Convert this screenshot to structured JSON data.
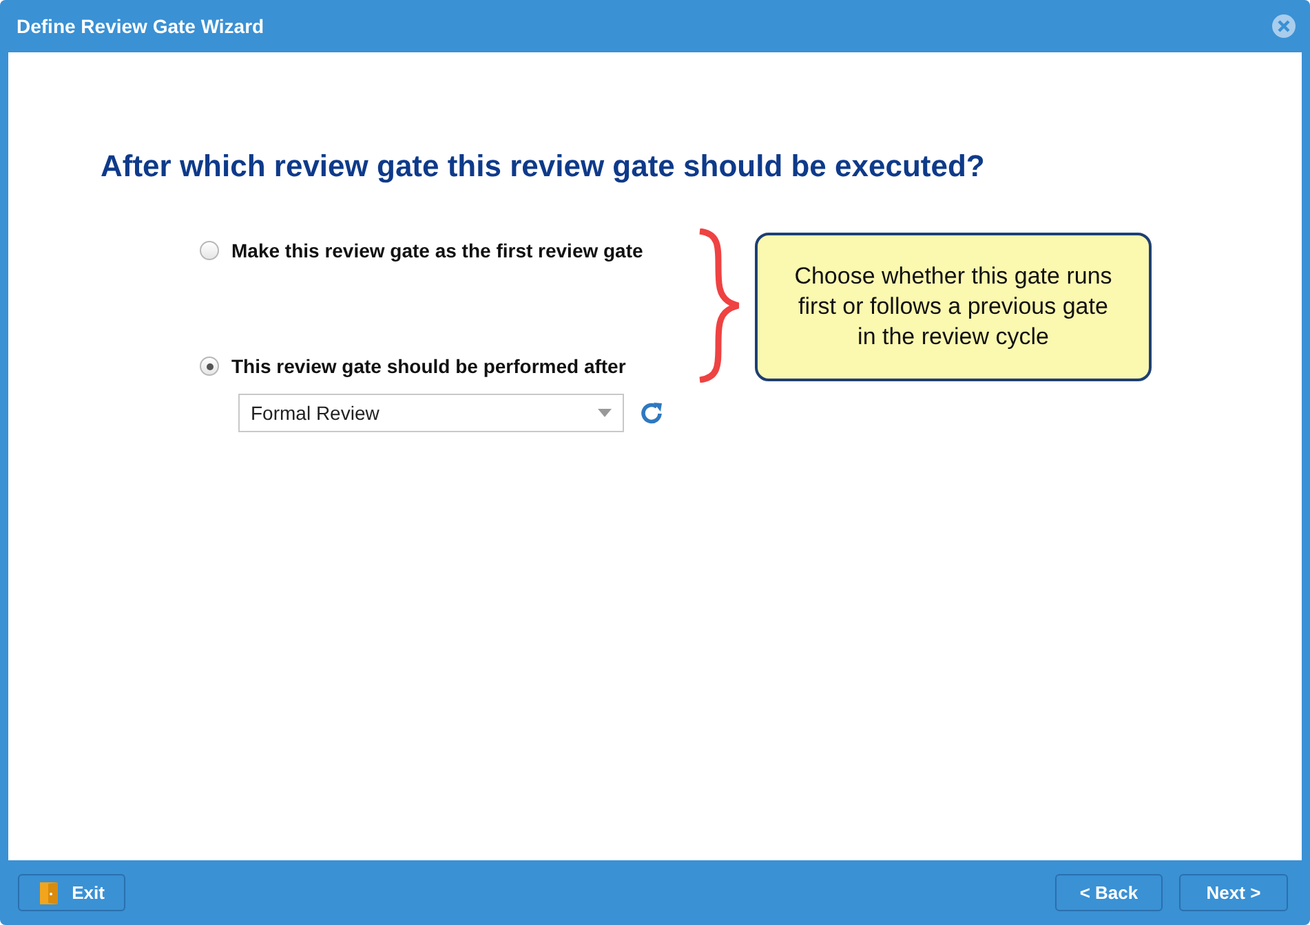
{
  "window": {
    "title": "Define Review Gate Wizard"
  },
  "heading": "After which review gate this review gate should be executed?",
  "options": [
    {
      "label": "Make this review gate as the first review gate",
      "selected": false
    },
    {
      "label": "This review gate should be performed after",
      "selected": true
    }
  ],
  "dropdown": {
    "value": "Formal Review"
  },
  "callout": {
    "text": "Choose whether this gate runs first or follows a previous gate in the review cycle"
  },
  "footer": {
    "exit": "Exit",
    "back": "< Back",
    "next": "Next >"
  }
}
